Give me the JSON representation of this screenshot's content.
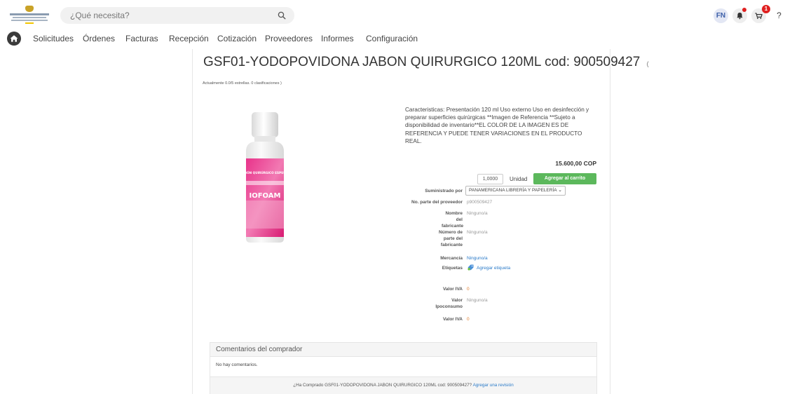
{
  "header": {
    "search_placeholder": "¿Qué necesita?",
    "user_initials": "FN",
    "cart_count": "1",
    "help_label": "?"
  },
  "nav": {
    "items": [
      "Solicitudes",
      "Órdenes",
      "Facturas",
      "Recepción",
      "Cotización",
      "Proveedores",
      "Informes",
      "Configuración"
    ]
  },
  "product": {
    "title": "GSF01-YODOPOVIDONA JABON QUIRURGICO 120ML cod: 900509427",
    "title_suffix": "(",
    "rating_text": "Actualmente 0.0/5 estrellas. 0 clasificaciones )",
    "image_label_top": "JABÓN QUIRÚRGICO ESPUMA",
    "image_brand": "IOFOAM",
    "description": "Caracteristicas: Presentación 120 ml Uso externo Uso en desinfección y preparar superficies quirúrgicas **Imagen de Referencia **Sujeto a disponibilidad de inventario**EL COLOR DE LA IMAGEN ES DE REFERENCIA Y PUEDE TENER VARIACIONES EN EL PRODUCTO REAL.",
    "price": "15.600,00 COP",
    "quantity": "1,0000",
    "unit": "Unidad",
    "add_to_cart_label": "Agregar al carrito",
    "colors": {
      "add_button": "#5cb85c",
      "link": "#2a7ac8",
      "accent_orange": "#e07b2a"
    }
  },
  "details": {
    "supplied_by_label": "Suministrado por",
    "supplier_value": "PANAMERICANA LIBRERÍA Y PAPELERÍA",
    "supplier_part_label": "No. parte del proveedor",
    "supplier_part_value": "p900509427",
    "manufacturer_name_label": "Nombre del fabricante",
    "manufacturer_name_value": "Ninguno/a",
    "manufacturer_part_label": "Número de parte del fabricante",
    "manufacturer_part_value": "Ninguno/a",
    "commodity_label": "Mercancía",
    "commodity_value": "Ninguno/a",
    "tags_label": "Etiquetas",
    "add_tag_label": "Agregar etiqueta",
    "iva_label": "Valor IVA",
    "iva_value": "0",
    "ipoconsumo_label": "Valor Ipoconsumo",
    "ipoconsumo_value": "Ninguno/a",
    "iva2_label": "Valor IVA",
    "iva2_value": "0"
  },
  "comments": {
    "title": "Comentarios del comprador",
    "empty_text": "No hay comentarios.",
    "review_prompt": "¿Ha Comprado GSF01-YODOPOVIDONA JABON QUIRURGICO 120ML cod: 900509427?",
    "review_link": "Agregar una revisión"
  }
}
